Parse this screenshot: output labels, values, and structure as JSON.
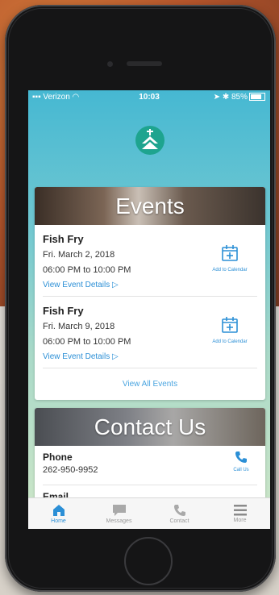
{
  "status_bar": {
    "carrier": "Verizon",
    "time": "10:03",
    "battery": "85%"
  },
  "events": {
    "banner_title": "Events",
    "items": [
      {
        "title": "Fish Fry",
        "date": "Fri. March 2, 2018",
        "time": "06:00 PM to 10:00 PM",
        "details_link": "View Event Details",
        "calendar_label": "Add to Calendar"
      },
      {
        "title": "Fish Fry",
        "date": "Fri. March 9, 2018",
        "time": "06:00 PM to 10:00 PM",
        "details_link": "View Event Details",
        "calendar_label": "Add to Calendar"
      }
    ],
    "view_all": "View All Events"
  },
  "contact": {
    "banner_title": "Contact Us",
    "phone_label": "Phone",
    "phone_value": "262-950-9952",
    "call_label": "Call Us",
    "email_label": "Email"
  },
  "tabs": [
    {
      "label": "Home",
      "icon": "home-icon",
      "active": true
    },
    {
      "label": "Messages",
      "icon": "messages-icon",
      "active": false
    },
    {
      "label": "Contact",
      "icon": "phone-icon",
      "active": false
    },
    {
      "label": "More",
      "icon": "menu-icon",
      "active": false
    }
  ],
  "colors": {
    "accent": "#2b8fd6",
    "logo": "#1ea48f"
  }
}
